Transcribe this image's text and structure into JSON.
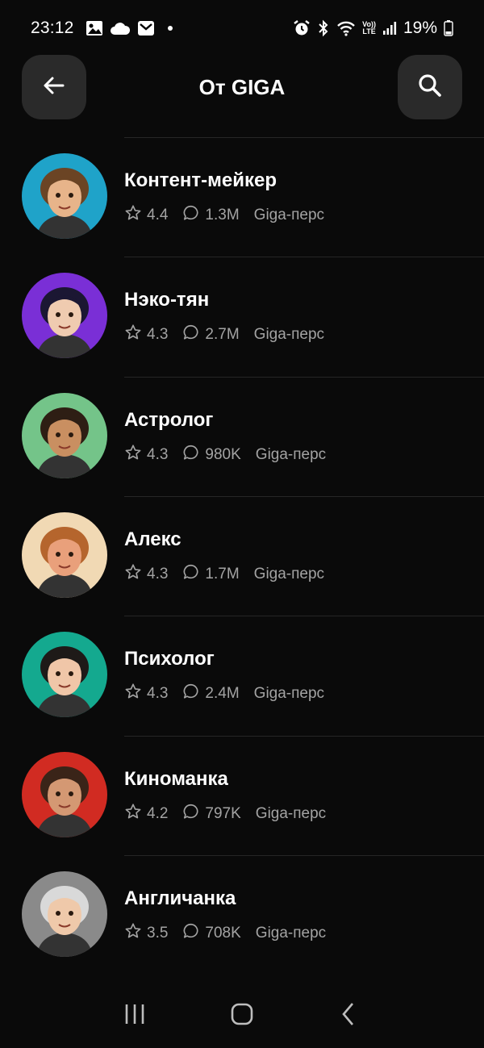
{
  "status_bar": {
    "time": "23:12",
    "battery": "19%",
    "left_icons": [
      "image-icon",
      "cloud-icon",
      "mail-icon",
      "dot-icon"
    ],
    "right_icons": [
      "alarm-icon",
      "bluetooth-icon",
      "wifi-icon",
      "volte-icon",
      "signal-icon",
      "battery-icon"
    ],
    "volte_top": "Vo))",
    "volte_bottom": "LTE"
  },
  "header": {
    "title": "От GIGA",
    "back_icon": "arrow-left-icon",
    "search_icon": "search-icon"
  },
  "characters": [
    {
      "name": "Контент-мейкер",
      "rating": "4.4",
      "chats": "1.3M",
      "tag": "Giga-перс",
      "avatar_bg": "#1fa3c9",
      "skin": "#e7b48a",
      "hair": "#6b4424"
    },
    {
      "name": "Нэко-тян",
      "rating": "4.3",
      "chats": "2.7M",
      "tag": "Giga-перс",
      "avatar_bg": "#7a2fd6",
      "skin": "#efcbb0",
      "hair": "#1b1733"
    },
    {
      "name": "Астролог",
      "rating": "4.3",
      "chats": "980K",
      "tag": "Giga-перс",
      "avatar_bg": "#74c489",
      "skin": "#c98f61",
      "hair": "#2e1e14"
    },
    {
      "name": "Алекс",
      "rating": "4.3",
      "chats": "1.7M",
      "tag": "Giga-перс",
      "avatar_bg": "#f1d9b4",
      "skin": "#e9a07b",
      "hair": "#b5652d"
    },
    {
      "name": "Психолог",
      "rating": "4.3",
      "chats": "2.4M",
      "tag": "Giga-перс",
      "avatar_bg": "#14a98f",
      "skin": "#f0c6a8",
      "hair": "#1e1a18"
    },
    {
      "name": "Киноманка",
      "rating": "4.2",
      "chats": "797K",
      "tag": "Giga-перс",
      "avatar_bg": "#d12b22",
      "skin": "#d49873",
      "hair": "#3a2418"
    },
    {
      "name": "Англичанка",
      "rating": "3.5",
      "chats": "708K",
      "tag": "Giga-перс",
      "avatar_bg": "#8a8a8a",
      "skin": "#efc9aa",
      "hair": "#d9d9d9"
    }
  ],
  "nav_bar": {
    "icons": [
      "recent-apps-icon",
      "home-icon",
      "back-icon"
    ]
  },
  "colors": {
    "background": "#0a0a0a",
    "button_bg": "#2a2a2a",
    "meta_text": "#a3a3a3",
    "divider": "#262626"
  }
}
